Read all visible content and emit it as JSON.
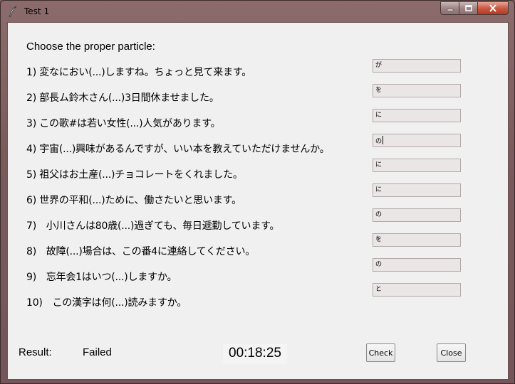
{
  "window": {
    "title": "Test 1"
  },
  "instruction": "Choose the proper particle:",
  "questions": [
    {
      "text": "1) 変なにおい(...)しますね。ちょっと見て来ます。",
      "answer": "が"
    },
    {
      "text": "2) 部長ム鈴木さん(...)3日間休ませました。",
      "answer": "を"
    },
    {
      "text": "3) この歌#は若い女性(...)人気があります。",
      "answer": "に"
    },
    {
      "text": "4) 宇宙(...)興味があるんですが、いい本を教えていただけませんか。",
      "answer": "の"
    },
    {
      "text": "5) 祖父はお土産(...)チョコレートをくれました。",
      "answer": "に"
    },
    {
      "text": "6) 世界の平和(...)ために、働さたいと思います。",
      "answer": "に"
    },
    {
      "text": "7)　小川さんは80歳(...)過ぎても、毎日遞勤しています。",
      "answer": "の"
    },
    {
      "text": "8)　故障(...)場合は、この番4に連絡してください。",
      "answer": "を"
    },
    {
      "text": "9)　忘年会1はいつ(...)しますか。",
      "answer": "の"
    },
    {
      "text": "10)　この漢字は何(...)読みますか。",
      "answer": "と"
    }
  ],
  "result": {
    "label": "Result:",
    "value": "Failed"
  },
  "timer": "00:18:25",
  "buttons": {
    "check": "Check",
    "close": "Close"
  },
  "icons": {
    "app": "quill-icon"
  }
}
